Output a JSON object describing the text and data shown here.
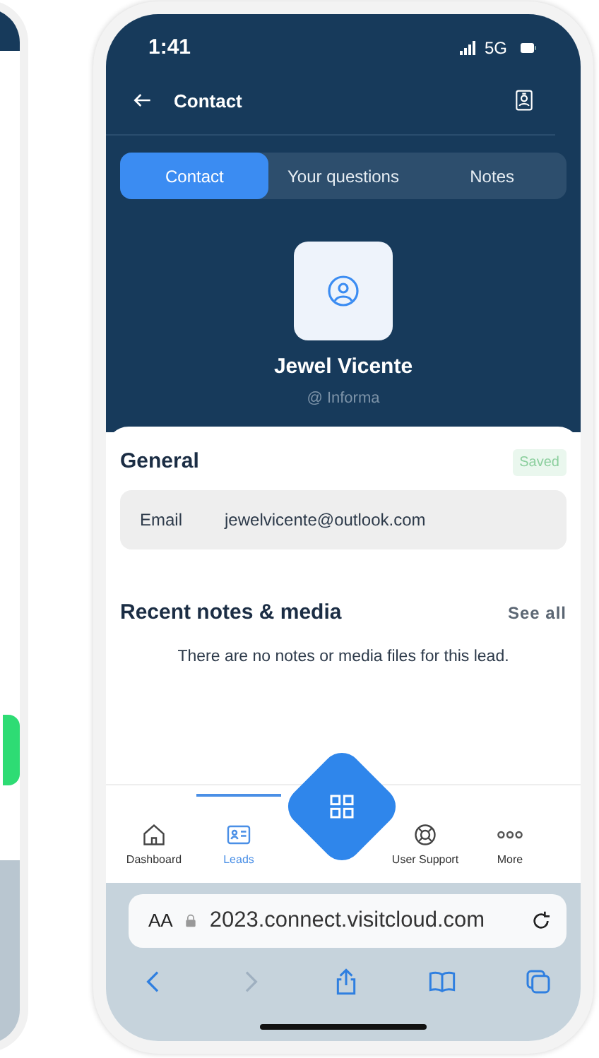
{
  "status_bar": {
    "time": "1:41",
    "network": "5G"
  },
  "header": {
    "title": "Contact"
  },
  "tabs": [
    {
      "label": "Contact",
      "selected": true
    },
    {
      "label": "Your questions",
      "selected": false
    },
    {
      "label": "Notes",
      "selected": false
    }
  ],
  "profile": {
    "name": "Jewel Vicente",
    "company": "@ Informa"
  },
  "general": {
    "title": "General",
    "badge": "Saved",
    "fields": [
      {
        "label": "Email",
        "value": "jewelvicente@outlook.com"
      }
    ]
  },
  "recent": {
    "title": "Recent notes & media",
    "action": "See all",
    "empty": "There are no notes or media files for this lead."
  },
  "nav": [
    {
      "label": "Dashboard",
      "selected": false
    },
    {
      "label": "Leads",
      "selected": true
    },
    {
      "label": "User Support",
      "selected": false
    },
    {
      "label": "More",
      "selected": false
    }
  ],
  "browser": {
    "text_size": "AA",
    "url": "2023.connect.visitcloud.com"
  }
}
